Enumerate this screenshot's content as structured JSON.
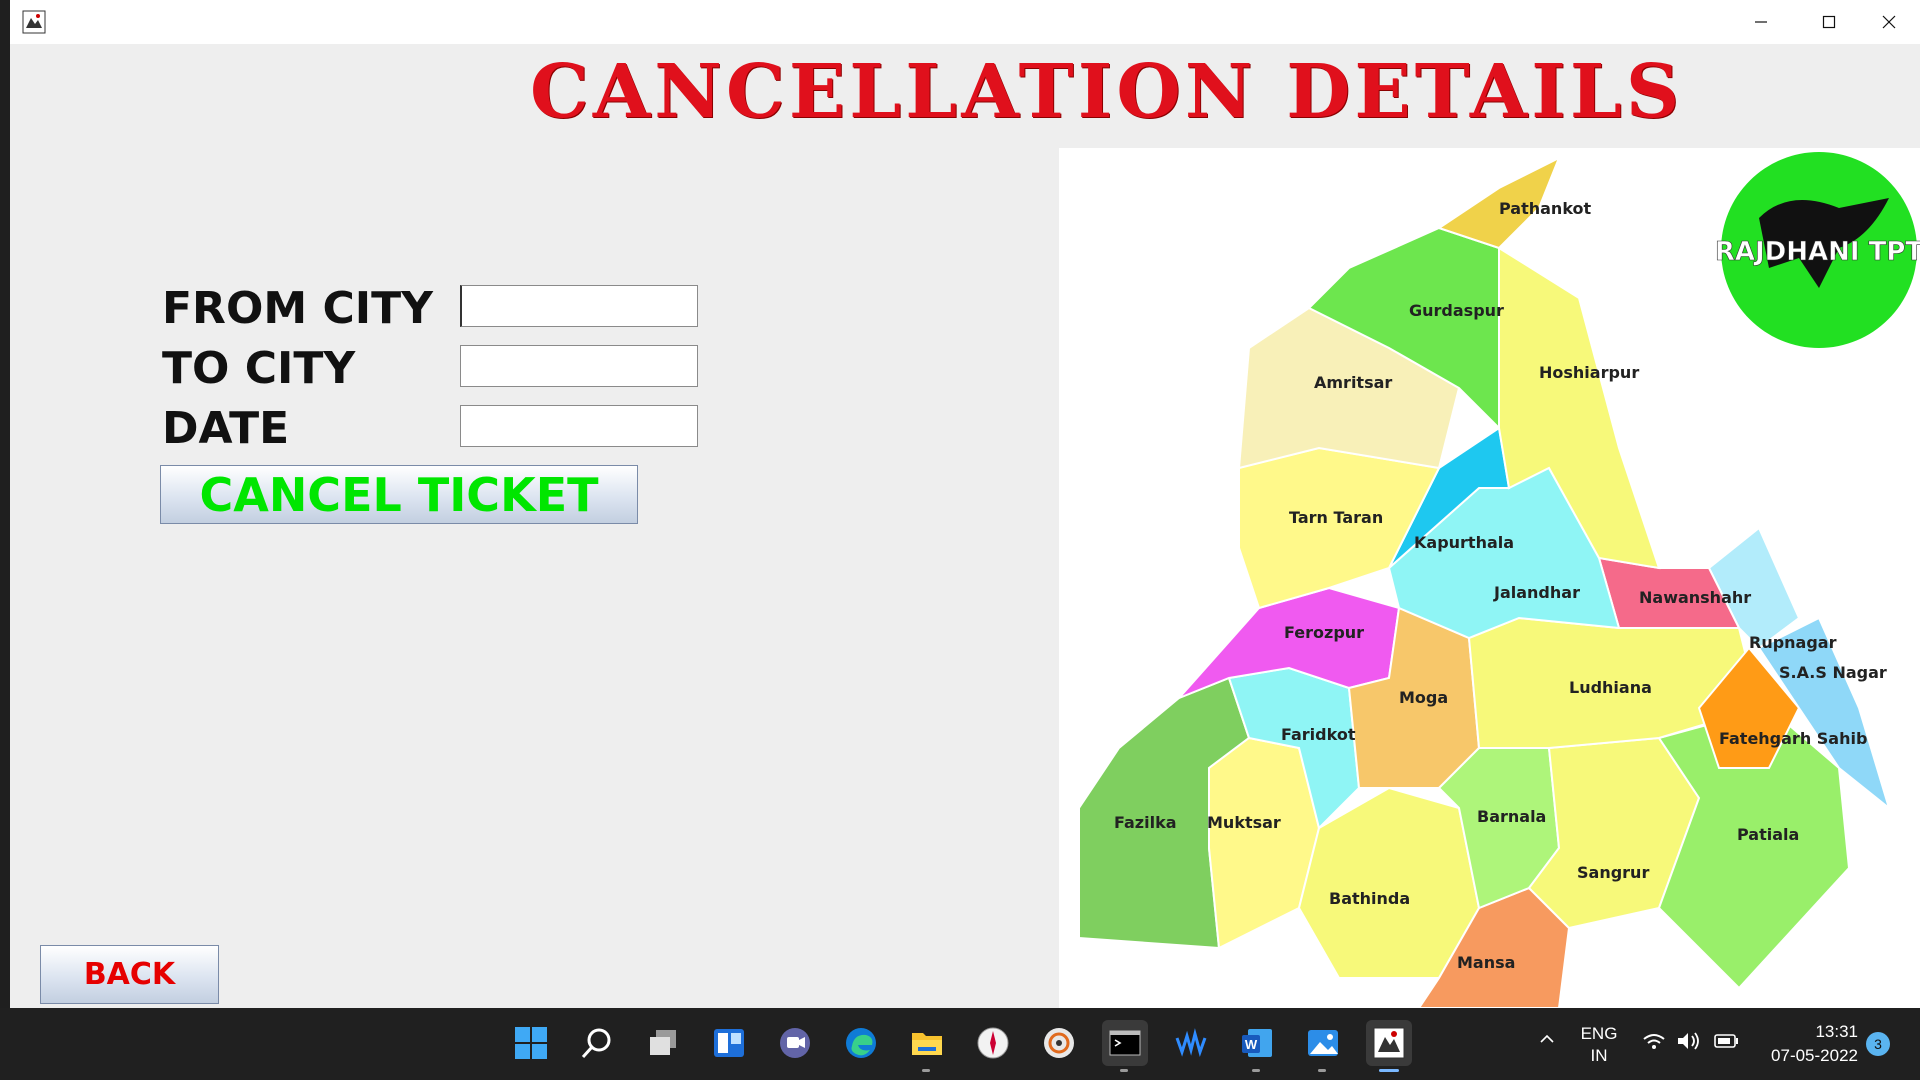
{
  "window": {
    "heading": "CANCELLATION DETAILS"
  },
  "form": {
    "from_city_label": "FROM CITY",
    "from_city_value": "",
    "to_city_label": "TO CITY",
    "to_city_value": "",
    "date_label": "DATE",
    "date_value": "",
    "cancel_button_label": "CANCEL TICKET",
    "back_button_label": "BACK"
  },
  "colors": {
    "heading": "#e0101c",
    "cancel_button_text": "#00e600",
    "back_button_text": "#e60000",
    "logo_circle": "#22e022"
  },
  "map": {
    "logo_text": "RAJDHANI TPT",
    "districts": [
      "Pathankot",
      "Gurdaspur",
      "Hoshiarpur",
      "Amritsar",
      "Tarn Taran",
      "Kapurthala",
      "Jalandhar",
      "Nawanshahr",
      "Ferozpur",
      "Rupnagar",
      "S.A.S Nagar",
      "Moga",
      "Ludhiana",
      "Faridkot",
      "Fatehgarh Sahib",
      "Fazilka",
      "Muktsar",
      "Barnala",
      "Patiala",
      "Sangrur",
      "Bathinda",
      "Mansa"
    ]
  },
  "taskbar": {
    "lang_primary": "ENG",
    "lang_secondary": "IN",
    "time": "13:31",
    "date": "07-05-2022",
    "notification_count": "3",
    "icons": [
      "start-icon",
      "search-icon",
      "task-view-icon",
      "widgets-icon",
      "chat-icon",
      "edge-icon",
      "file-explorer-icon",
      "compass-app-icon",
      "media-app-icon",
      "terminal-icon",
      "audio-app-icon",
      "word-icon",
      "photos-icon",
      "java-app-icon"
    ]
  }
}
